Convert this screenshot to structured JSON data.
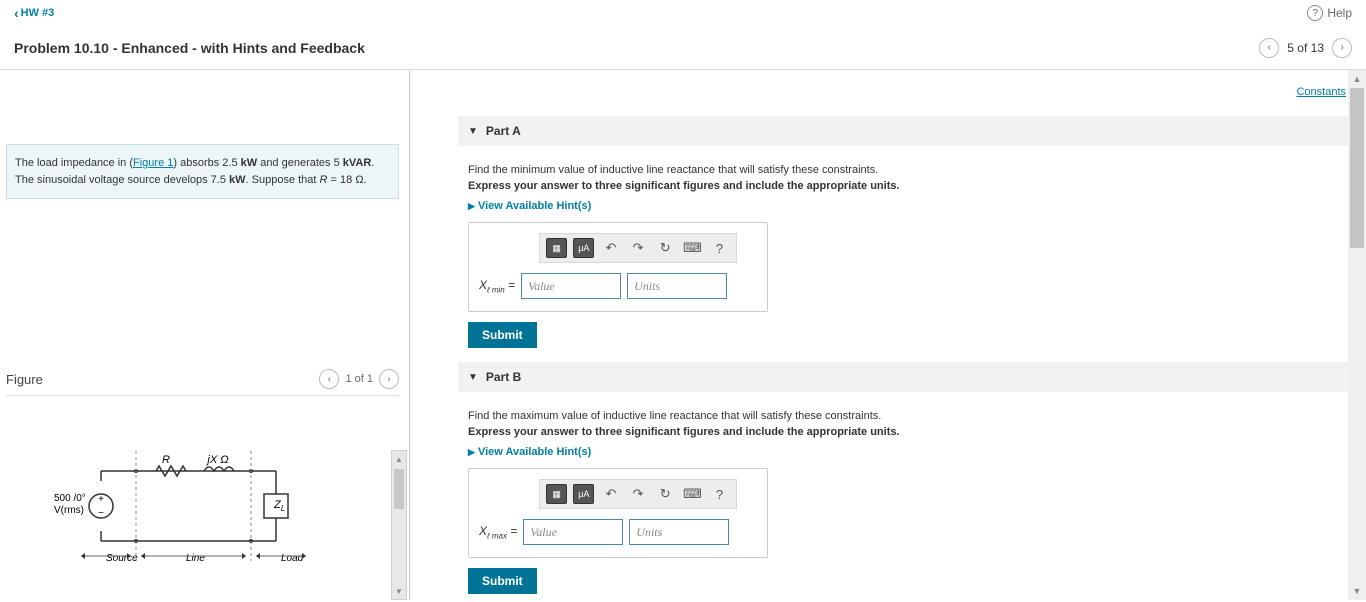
{
  "breadcrumb": {
    "back_label": "HW #3"
  },
  "help": {
    "label": "Help"
  },
  "title": "Problem 10.10 - Enhanced - with Hints and Feedback",
  "nav": {
    "position": "5 of 13"
  },
  "problem": {
    "text_prefix": "The load impedance in (",
    "figure_link": "Figure 1",
    "text_mid1": ") absorbs 2.5 ",
    "kw1": "kW",
    "text_mid2": " and generates 5 ",
    "kvar": "kVAR",
    "text_mid3": ". The sinusoidal voltage source develops 7.5 ",
    "kw2": "kW",
    "text_mid4": ". Suppose that ",
    "r_label": "R",
    "r_eq": " = 18 ",
    "ohm": "Ω",
    "period": "."
  },
  "figure": {
    "heading": "Figure",
    "nav": "1 of 1",
    "labels": {
      "v_top": "500 /0°",
      "v_bot": "V(rms)",
      "R": "R",
      "jX": "jX Ω",
      "ZL": "Z",
      "ZL_sub": "L",
      "source": "Source",
      "line": "Line",
      "load": "Load"
    }
  },
  "constants_link": "Constants",
  "parts": {
    "a": {
      "header": "Part A",
      "prompt": "Find the minimum value of inductive line reactance that will satisfy these constraints.",
      "format": "Express your answer to three significant figures and include the appropriate units.",
      "hints": "View Available Hint(s)",
      "var_html": "X<sub>ℓ min</sub> =",
      "value_ph": "Value",
      "units_ph": "Units",
      "submit": "Submit"
    },
    "b": {
      "header": "Part B",
      "prompt": "Find the maximum value of inductive line reactance that will satisfy these constraints.",
      "format": "Express your answer to three significant figures and include the appropriate units.",
      "hints": "View Available Hint(s)",
      "var_html": "X<sub>ℓ max</sub> =",
      "value_ph": "Value",
      "units_ph": "Units",
      "submit": "Submit"
    }
  },
  "toolbar": {
    "t1": "▦",
    "t2": "μA",
    "undo": "↶",
    "redo": "↷",
    "reset": "↻",
    "kbd": "⌨",
    "help": "?"
  }
}
